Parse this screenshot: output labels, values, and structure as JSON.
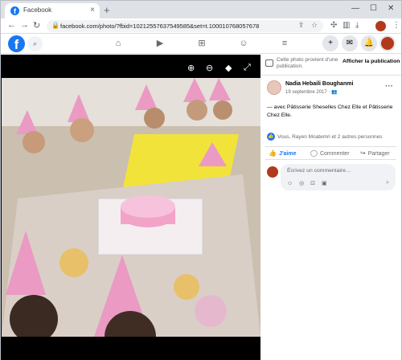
{
  "browser": {
    "tab_title": "Facebook",
    "tab_close": "×",
    "new_tab": "+",
    "window_controls": [
      "—",
      "☐",
      "✕"
    ],
    "nav_buttons": [
      "←",
      "→",
      "↻"
    ],
    "url": "facebook.com/photo/?fbid=10212557637549585&set=t.100010768057678",
    "omnibox_icons": [
      "share-icon",
      "star-icon"
    ],
    "toolbar_icons": [
      "extensions-icon",
      "sidepanel-icon",
      "menu-icon"
    ]
  },
  "fb_nav": {
    "logo": "f",
    "search_glyph": "⌕",
    "nav_icons": [
      {
        "name": "home-icon",
        "glyph": "⌂"
      },
      {
        "name": "watch-icon",
        "glyph": "▶"
      },
      {
        "name": "marketplace-icon",
        "glyph": "⊞"
      },
      {
        "name": "groups-icon",
        "glyph": "☺"
      },
      {
        "name": "menu-lines-icon",
        "glyph": "≡"
      }
    ],
    "round_buttons": [
      {
        "name": "create-icon",
        "glyph": "+"
      },
      {
        "name": "messenger-icon",
        "glyph": "✉"
      },
      {
        "name": "notifications-icon",
        "glyph": "🔔"
      }
    ]
  },
  "viewer": {
    "controls": [
      {
        "name": "zoom-in-icon",
        "glyph": "⊕"
      },
      {
        "name": "zoom-out-icon",
        "glyph": "⊖"
      },
      {
        "name": "tag-icon",
        "glyph": "◆"
      },
      {
        "name": "fullscreen-icon",
        "glyph": "⤢"
      }
    ],
    "photo_alt": "Photo"
  },
  "post": {
    "notice_text": "Cette photo provient d’une publication.",
    "notice_button": "Afficher la publication",
    "author": "Nadia Hebaili Boughanmi",
    "date": "19 septembre 2017 · 👥",
    "more": "···",
    "caption": "— avec Pâtisserie Sheselles Chez Elle et Pâtisserie Chez Elle.",
    "reactions_text": "Vous, Rayen Moatemri et 2 autres personnes",
    "like_glyph": "👍",
    "actions": {
      "like": "J'aime",
      "comment": "Commenter",
      "share": "Partager"
    },
    "comment_placeholder": "Écrivez un commentaire…",
    "comment_tools": "☺ ◎ ⊡ ▣",
    "send": "➤"
  }
}
